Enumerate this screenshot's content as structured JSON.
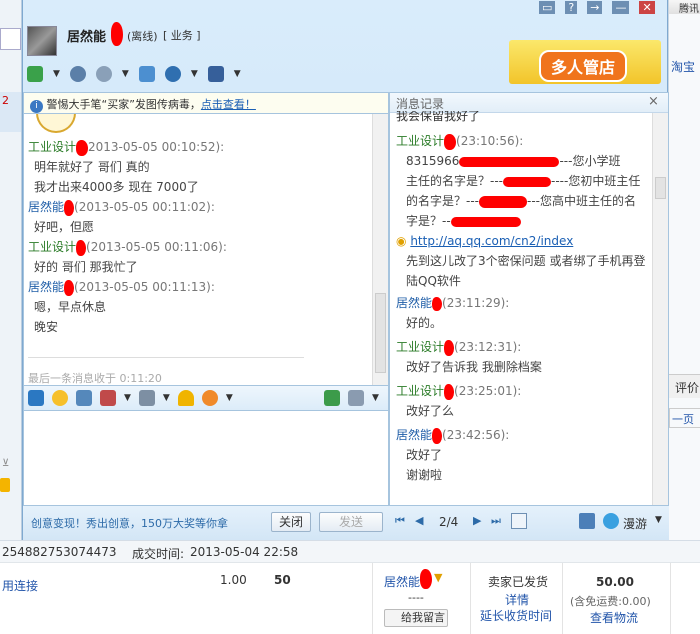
{
  "background": {
    "right_tab_label": "腾讯",
    "right_link": "淘宝",
    "right_link2": "评价",
    "right_link3": "一页",
    "left_number": "2",
    "order_id": "254882753074473",
    "deal_time_label": "成交时间:",
    "deal_time": "2013-05-04 22:58",
    "item_link": "用连接",
    "price": "1.00",
    "qty": "50",
    "buyer_name": "居然能",
    "buyer_dash": "----",
    "leave_msg_label": "给我留言",
    "status": "卖家已发货",
    "detail_link": "详情",
    "extend_link": "延长收货时间",
    "total": "50.00",
    "shipping_note": "(含免运费:0.00)",
    "logistics_link": "查看物流"
  },
  "header": {
    "contact_name": "居然能",
    "status": "(离线)",
    "group_link": "[ 业务 ]",
    "banner_text": "多人管店",
    "window_buttons": [
      "▭",
      "?",
      "→",
      "—",
      "✕"
    ]
  },
  "warning": {
    "text": "警惕大手笔“买家”发图传病毒，",
    "link": "点击查看！"
  },
  "chat": {
    "messages": [
      {
        "name": "工业设计",
        "time": "2013-05-05 00:10:52):",
        "lines": [
          "明年就好了 哥们 真的",
          "我才出来4000多 现在 7000了"
        ],
        "color": "green"
      },
      {
        "name": "居然能",
        "time": "(2013-05-05 00:11:02):",
        "lines": [
          "好吧，但愿"
        ],
        "color": "blue"
      },
      {
        "name": "工业设计",
        "time": "(2013-05-05 00:11:06):",
        "lines": [
          "好的 哥们 那我忙了"
        ],
        "color": "green"
      },
      {
        "name": "居然能",
        "time": "(2013-05-05 00:11:13):",
        "lines": [
          "嗯，早点休息",
          "晚安"
        ],
        "color": "blue"
      }
    ],
    "last_msg_note": "最后一条消息收于 0:11:20"
  },
  "history": {
    "title": "消息记录",
    "close": "×",
    "top_line": "我会保留我好了",
    "entries": [
      {
        "name": "工业设计",
        "time": "(23:10:56):",
        "lines": [
          "8315966",
          "主任的名字是？---",
          "的名字是？---",
          "字是？--"
        ],
        "color": "green",
        "tails": [
          "---您小学班",
          "----您初中班主任",
          "---您高中班主任的名"
        ]
      },
      {
        "name": "",
        "time": "",
        "lines": [
          "先到这儿改了3个密保问题  或者绑了手机再登陆QQ软件"
        ],
        "color": "green",
        "link": "http://aq.qq.com/cn2/index"
      },
      {
        "name": "居然能",
        "time": "(23:11:29):",
        "lines": [
          "好的。"
        ],
        "color": "blue"
      },
      {
        "name": "工业设计",
        "time": "(23:12:31):",
        "lines": [
          "改好了告诉我 我删除档案"
        ],
        "color": "green"
      },
      {
        "name": "工业设计",
        "time": "(23:25:01):",
        "lines": [
          "改好了么"
        ],
        "color": "green"
      },
      {
        "name": "居然能",
        "time": "(23:42:56):",
        "lines": [
          "改好了",
          "谢谢啦"
        ],
        "color": "blue"
      }
    ]
  },
  "bottom": {
    "promo": "创意变现！秀出创意，150万大奖等你拿",
    "close_btn": "关闭",
    "send_btn": "发送",
    "page": "2/4",
    "roam": "漫游"
  }
}
